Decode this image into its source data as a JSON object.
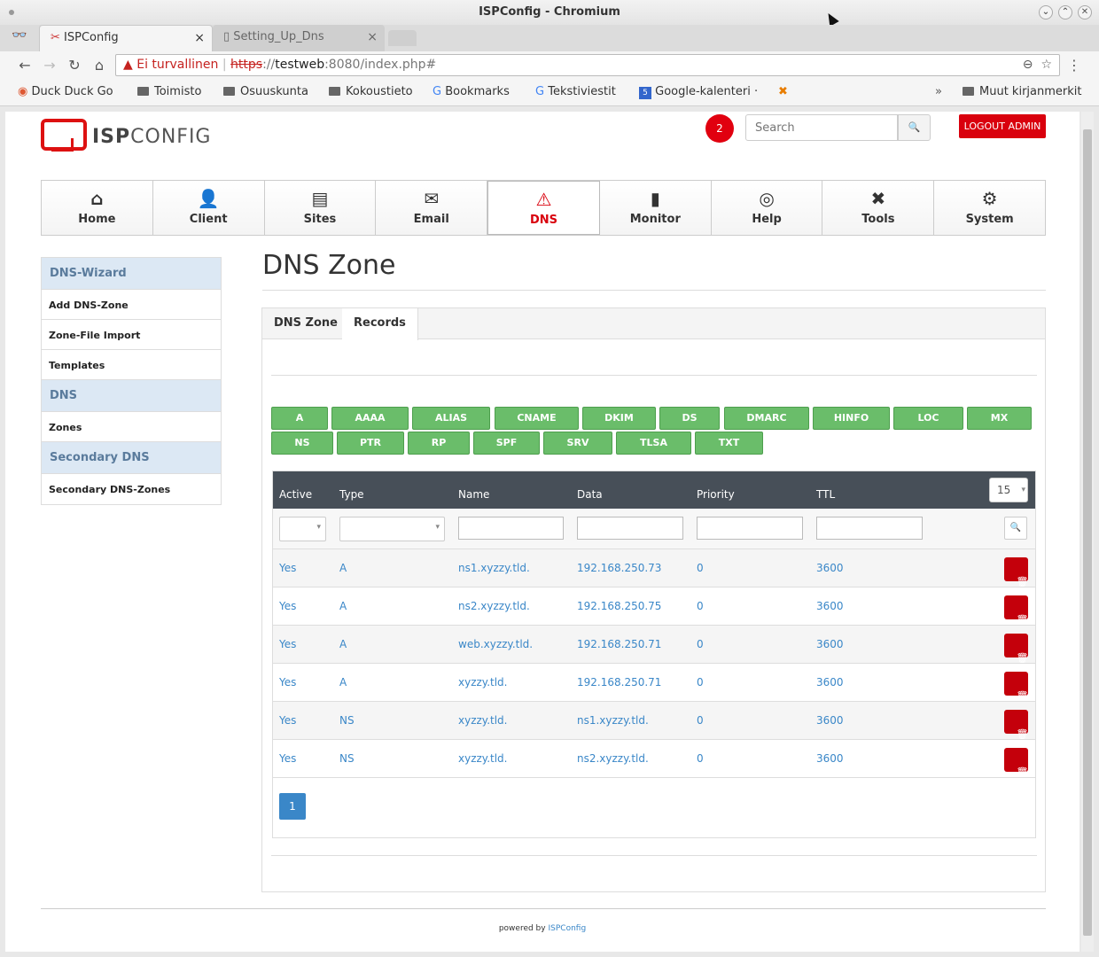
{
  "window": {
    "title": "ISPConfig - Chromium"
  },
  "tabs": [
    {
      "label": "ISPConfig",
      "close": "×"
    },
    {
      "label": "Setting_Up_Dns",
      "close": "×"
    }
  ],
  "address": {
    "warning": "Ei turvallinen",
    "scheme": "https",
    "sep": "://",
    "host": "testweb",
    "path": ":8080/index.php#"
  },
  "bookmarks": [
    "Duck Duck Go",
    "Toimisto",
    "Osuuskunta",
    "Kokoustieto",
    "Bookmarks",
    "Tekstiviestit",
    "Google-kalenteri ·",
    "Muut kirjanmerkit"
  ],
  "bookmarks_more": "»",
  "header": {
    "logo_left": "ISP",
    "logo_right": "CONFIG",
    "badge": "2",
    "search_placeholder": "Search",
    "logout": "LOGOUT ADMIN"
  },
  "nav": [
    {
      "label": "Home",
      "icon": "home-icon",
      "glyph": "⌂"
    },
    {
      "label": "Client",
      "icon": "client-icon",
      "glyph": "👤"
    },
    {
      "label": "Sites",
      "icon": "sites-icon",
      "glyph": "▤"
    },
    {
      "label": "Email",
      "icon": "email-icon",
      "glyph": "✉"
    },
    {
      "label": "DNS",
      "icon": "dns-icon",
      "glyph": "⚠"
    },
    {
      "label": "Monitor",
      "icon": "monitor-icon",
      "glyph": "▮"
    },
    {
      "label": "Help",
      "icon": "help-icon",
      "glyph": "◎"
    },
    {
      "label": "Tools",
      "icon": "tools-icon",
      "glyph": "✖"
    },
    {
      "label": "System",
      "icon": "system-icon",
      "glyph": "⚙"
    }
  ],
  "sidebar": {
    "wizard_header": "DNS-Wizard",
    "wizard_items": [
      "Add DNS-Zone",
      "Zone-File Import",
      "Templates"
    ],
    "dns_header": "DNS",
    "dns_items": [
      "Zones"
    ],
    "secondary_header": "Secondary DNS",
    "secondary_items": [
      "Secondary DNS-Zones"
    ]
  },
  "main": {
    "title": "DNS Zone",
    "tabs": [
      "DNS Zone",
      "Records"
    ],
    "record_types": [
      "A",
      "AAAA",
      "ALIAS",
      "CNAME",
      "DKIM",
      "DS",
      "DMARC",
      "HINFO",
      "LOC",
      "MX",
      "NS",
      "PTR",
      "RP",
      "SPF",
      "SRV",
      "TLSA",
      "TXT"
    ],
    "columns": [
      "Active",
      "Type",
      "Name",
      "Data",
      "Priority",
      "TTL"
    ],
    "per_page": "15",
    "rows": [
      {
        "active": "Yes",
        "type": "A",
        "name": "ns1.xyzzy.tld.",
        "data": "192.168.250.73",
        "priority": "0",
        "ttl": "3600"
      },
      {
        "active": "Yes",
        "type": "A",
        "name": "ns2.xyzzy.tld.",
        "data": "192.168.250.75",
        "priority": "0",
        "ttl": "3600"
      },
      {
        "active": "Yes",
        "type": "A",
        "name": "web.xyzzy.tld.",
        "data": "192.168.250.71",
        "priority": "0",
        "ttl": "3600"
      },
      {
        "active": "Yes",
        "type": "A",
        "name": "xyzzy.tld.",
        "data": "192.168.250.71",
        "priority": "0",
        "ttl": "3600"
      },
      {
        "active": "Yes",
        "type": "NS",
        "name": "xyzzy.tld.",
        "data": "ns1.xyzzy.tld.",
        "priority": "0",
        "ttl": "3600"
      },
      {
        "active": "Yes",
        "type": "NS",
        "name": "xyzzy.tld.",
        "data": "ns2.xyzzy.tld.",
        "priority": "0",
        "ttl": "3600"
      }
    ],
    "page": "1"
  },
  "footer": {
    "prefix": "powered by",
    "link": "ISPConfig"
  },
  "colors": {
    "accent": "#d9000d",
    "record_button": "#6abd6a",
    "link": "#3a87c8",
    "grid_header": "#474f58"
  }
}
